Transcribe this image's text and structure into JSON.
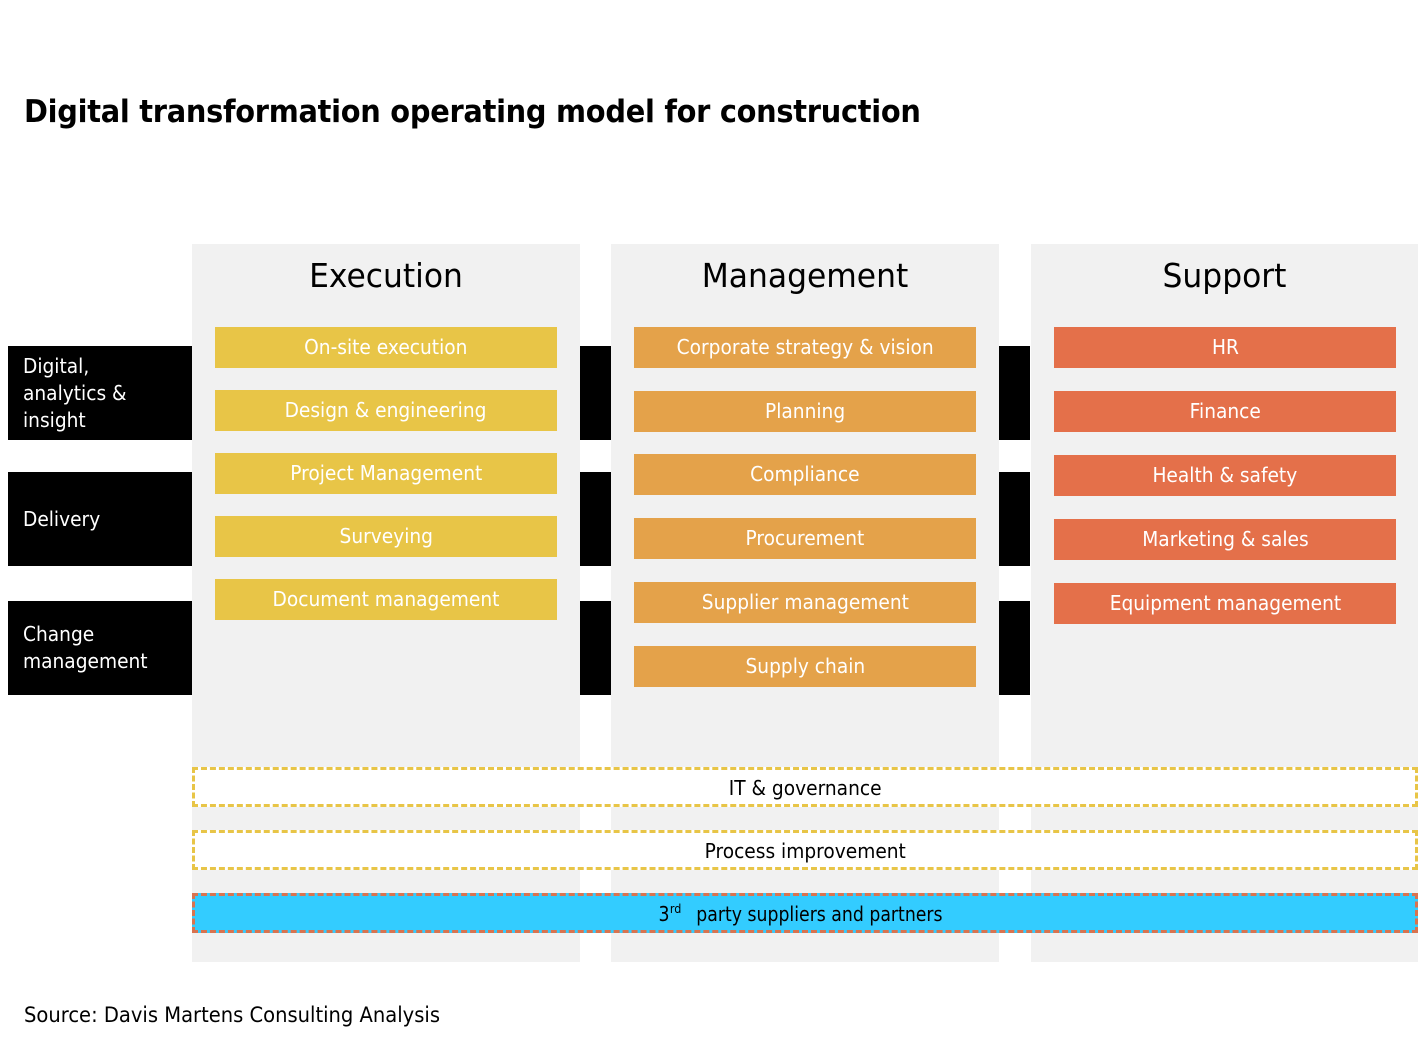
{
  "title": "Digital transformation operating model for construction",
  "columns": [
    {
      "header": "Execution",
      "color": "#e8c547",
      "items": [
        "On-site execution",
        "Design & engineering",
        "Project Management",
        "Surveying",
        "Document management"
      ]
    },
    {
      "header": "Management",
      "color": "#e4a24a",
      "items": [
        "Corporate strategy & vision",
        "Planning",
        "Compliance",
        "Procurement",
        "Supplier management",
        "Supply chain"
      ]
    },
    {
      "header": "Support",
      "color": "#e4704a",
      "items": [
        "HR",
        "Finance",
        "Health & safety",
        "Marketing & sales",
        "Equipment management"
      ]
    }
  ],
  "rows": [
    {
      "label": "Digital, analytics & insight"
    },
    {
      "label": "Delivery"
    },
    {
      "label": "Change management"
    }
  ],
  "bands": {
    "it_governance": "IT & governance",
    "process_improvement": "Process improvement",
    "third_party_prefix": "3",
    "third_party_sup": "rd",
    "third_party_rest": " party suppliers and partners"
  },
  "colors": {
    "column_bg": "#f1f1f1",
    "row_label_bg": "#000000",
    "third_party_bg": "#33ccff",
    "third_party_border": "#d9734f",
    "dashed_border": "#e8c547"
  },
  "source": "Source: Davis Martens Consulting Analysis"
}
